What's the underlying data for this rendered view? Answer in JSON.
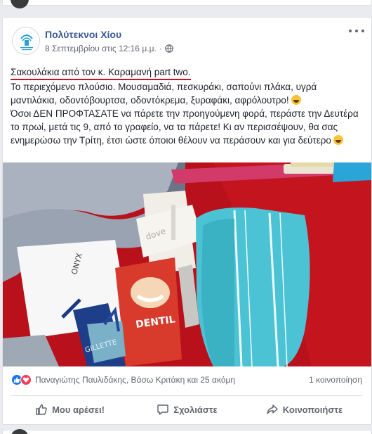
{
  "post": {
    "page_name": "Πολύτεκνοι Χίου",
    "date": "8 Σεπτεμβρίου στις 12:16 μ.μ.",
    "separator": "·",
    "headline": "Σακουλάκια από τον κ. Καραμανή part two.",
    "line1": "Το περιεχόμενο πλούσιο. Μουσαμαδιά, πεσκυράκι, σαπούνι πλάκα, υγρά μαντιλάκια, οδοντόβουρτσα, οδοντόκρεμα, ξυραφάκι, αφρόλουτρο!",
    "line2": "Όσοι ΔΕΝ ΠΡΟΦΤΑΣΑΤΕ να πάρετε την προηγούμενη φορά, περάστε την Δευτέρα το πρωί, μετά τις 9, από το γραφείο, να τα πάρετε! Κι αν περισσέψουν, θα σας ενημερώσω την Τρίτη, έτσι ώστε όποιοι θέλουν να περάσουν και για δεύτερο",
    "photo_labels": {
      "brand1": "ONYX",
      "brand2": "DENTIL",
      "brand3": "GILLETTE",
      "brand4": "dove"
    }
  },
  "reactions": {
    "names": "Παναγιώτης Παυλιδάκης, Βάσω Κριτάκη και 25 ακόμη",
    "shares": "1 κοινοποίηση"
  },
  "actions": {
    "like": "Μου αρέσει!",
    "comment": "Σχολιάστε",
    "share": "Κοινοποιήστε"
  },
  "colors": {
    "link": "#385898",
    "underline": "#c8102e",
    "like": "#1877f2",
    "love": "#f33e58"
  }
}
